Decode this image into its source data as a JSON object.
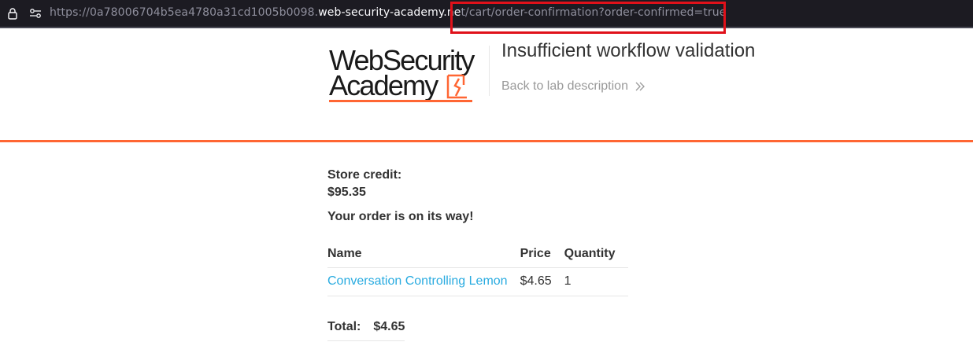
{
  "browser": {
    "url_dim_prefix": "https://0a78006704b5ea4780a31cd1005b0098.",
    "url_domain": "web-security-academy.ne",
    "url_dim_path": "t/cart/order-confirmation?order-confirmed=true",
    "icons": [
      "lock-icon",
      "permissions-icon"
    ],
    "highlight_color": "#e0111a"
  },
  "header": {
    "logo_line1": "WebSecurity",
    "logo_line2": "Academy",
    "lab_title": "Insufficient workflow validation",
    "back_link": "Back to lab description",
    "accent_color": "#ff6633"
  },
  "order": {
    "store_credit_label": "Store credit:",
    "store_credit_value": "$95.35",
    "message": "Your order is on its way!",
    "columns": [
      "Name",
      "Price",
      "Quantity"
    ],
    "items": [
      {
        "name": "Conversation Controlling Lemon",
        "price": "$4.65",
        "quantity": "1"
      }
    ],
    "total_label": "Total:",
    "total_value": "$4.65",
    "link_color": "#29abe0"
  }
}
